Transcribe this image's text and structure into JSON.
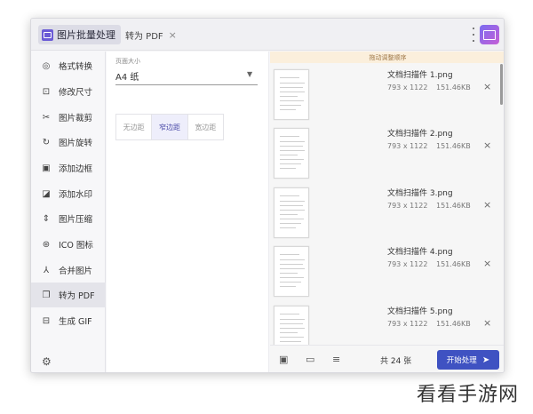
{
  "titlebar": {
    "home_tab_label": "图片批量处理",
    "active_tab_label": "转为 PDF",
    "close_glyph": "×"
  },
  "sidebar": {
    "items": [
      {
        "label": "格式转换",
        "icon": "format-convert-icon",
        "glyph": "◎"
      },
      {
        "label": "修改尺寸",
        "icon": "resize-icon",
        "glyph": "⊡"
      },
      {
        "label": "图片裁剪",
        "icon": "scissors-icon",
        "glyph": "✂"
      },
      {
        "label": "图片旋转",
        "icon": "rotate-icon",
        "glyph": "↻"
      },
      {
        "label": "添加边框",
        "icon": "border-icon",
        "glyph": "▣"
      },
      {
        "label": "添加水印",
        "icon": "watermark-icon",
        "glyph": "◪"
      },
      {
        "label": "图片压缩",
        "icon": "compress-icon",
        "glyph": "⇕"
      },
      {
        "label": "ICO 图标",
        "icon": "ico-icon",
        "glyph": "⊛"
      },
      {
        "label": "合并图片",
        "icon": "merge-icon",
        "glyph": "⅄"
      },
      {
        "label": "转为 PDF",
        "icon": "pdf-icon",
        "glyph": "❐"
      },
      {
        "label": "生成 GIF",
        "icon": "gif-icon",
        "glyph": "⊟"
      }
    ],
    "active_index": 9,
    "settings_icon": "gear-icon",
    "settings_glyph": "⚙"
  },
  "settings": {
    "page_size_label": "页面大小",
    "page_size_value": "A4 纸",
    "margin_options": [
      "无边距",
      "窄边距",
      "宽边距"
    ],
    "margin_selected": "窄边距"
  },
  "files": {
    "hint": "拖动调整顺序",
    "items": [
      {
        "name": "文档扫描件 1.png",
        "dimensions": "793 x 1122",
        "size": "151.46KB"
      },
      {
        "name": "文档扫描件 2.png",
        "dimensions": "793 x 1122",
        "size": "151.46KB"
      },
      {
        "name": "文档扫描件 3.png",
        "dimensions": "793 x 1122",
        "size": "151.46KB"
      },
      {
        "name": "文档扫描件 4.png",
        "dimensions": "793 x 1122",
        "size": "151.46KB"
      },
      {
        "name": "文档扫描件 5.png",
        "dimensions": "793 x 1122",
        "size": "151.46KB"
      }
    ],
    "remove_glyph": "×"
  },
  "bottombar": {
    "add_image_icon": "add-image-icon",
    "folder_icon": "folder-icon",
    "clear_icon": "clear-list-icon",
    "count_text": "共 24 张",
    "start_label": "开始处理",
    "start_arrow": "➤",
    "accent_color": "#3f52c2"
  },
  "watermark": {
    "text": "看看手游网"
  }
}
